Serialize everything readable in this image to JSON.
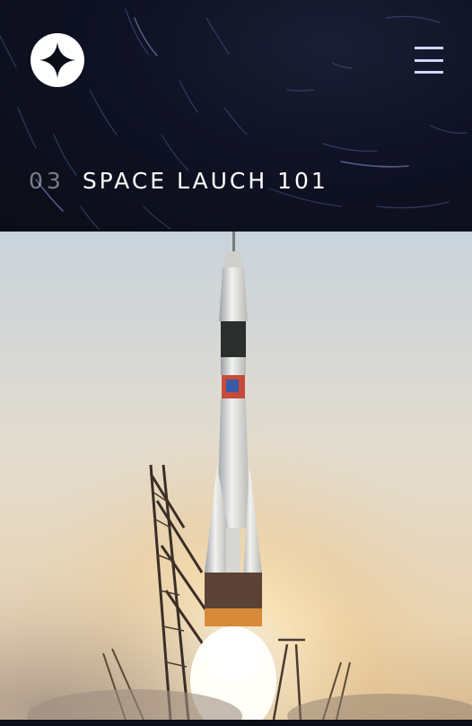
{
  "header": {
    "logo_icon": "four-point-star-icon",
    "menu_icon": "hamburger-menu-icon",
    "step_number": "03",
    "step_title": "SPACE LAUCH 101"
  },
  "image": {
    "subject": "rocket-launch-photo"
  },
  "colors": {
    "background": "#0b0d17",
    "accent": "#d0d6f9",
    "text": "#ffffff"
  }
}
